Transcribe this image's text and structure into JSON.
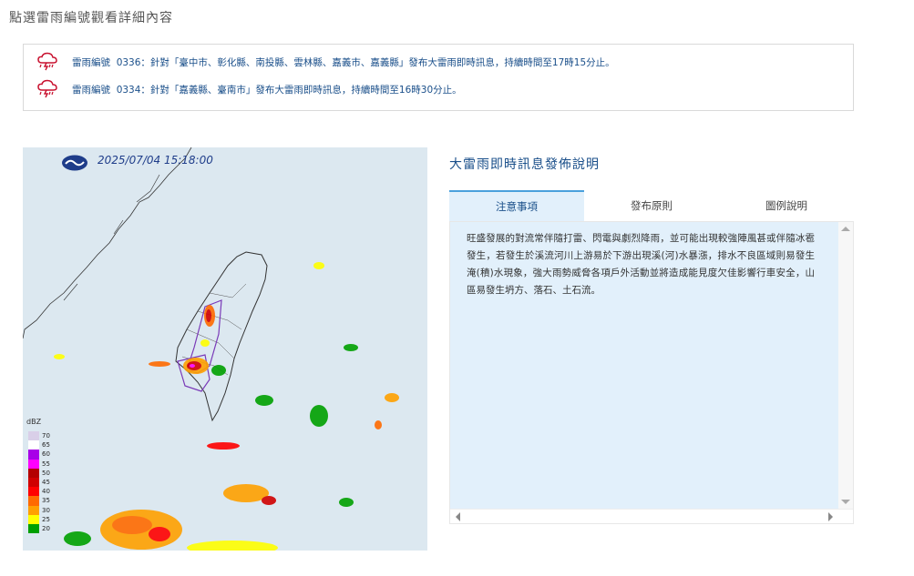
{
  "page": {
    "heading": "點選雷雨編號觀看詳細內容"
  },
  "warnings": [
    {
      "prefix": "雷雨編號",
      "number": "0336",
      "text": "：針對「臺中市、彰化縣、南投縣、雲林縣、嘉義市、嘉義縣」發布大雷雨即時訊息，持續時間至17時15分止。"
    },
    {
      "prefix": "雷雨編號",
      "number": "0334",
      "text": "：針對「嘉義縣、臺南市」發布大雷雨即時訊息，持續時間至16時30分止。"
    }
  ],
  "radar": {
    "timestamp": "2025/07/04 15:18:00",
    "unit": "dBZ",
    "legend": [
      {
        "label": "70",
        "color": "#d9cfe8"
      },
      {
        "label": "65",
        "color": "#ffffff"
      },
      {
        "label": "60",
        "color": "#a800e8"
      },
      {
        "label": "55",
        "color": "#ff00ff"
      },
      {
        "label": "50",
        "color": "#b40000"
      },
      {
        "label": "45",
        "color": "#d00000"
      },
      {
        "label": "40",
        "color": "#ff0000"
      },
      {
        "label": "35",
        "color": "#ff6a00"
      },
      {
        "label": "30",
        "color": "#ffa000"
      },
      {
        "label": "25",
        "color": "#ffff00"
      },
      {
        "label": "20",
        "color": "#00a000"
      }
    ]
  },
  "info": {
    "title": "大雷雨即時訊息發佈說明",
    "tabs": [
      {
        "label": "注意事項",
        "active": true
      },
      {
        "label": "發布原則",
        "active": false
      },
      {
        "label": "圖例說明",
        "active": false
      }
    ],
    "content": "旺盛發展的對流常伴隨打雷、閃電與劇烈降雨，並可能出現較強陣風甚或伴隨冰雹發生，若發生於溪流河川上游易於下游出現溪(河)水暴漲，排水不良區域則易發生淹(積)水現象，強大雨勢威脅各項戶外活動並將造成能見度欠佳影響行車安全，山區易發生坍方、落石、土石流。"
  }
}
